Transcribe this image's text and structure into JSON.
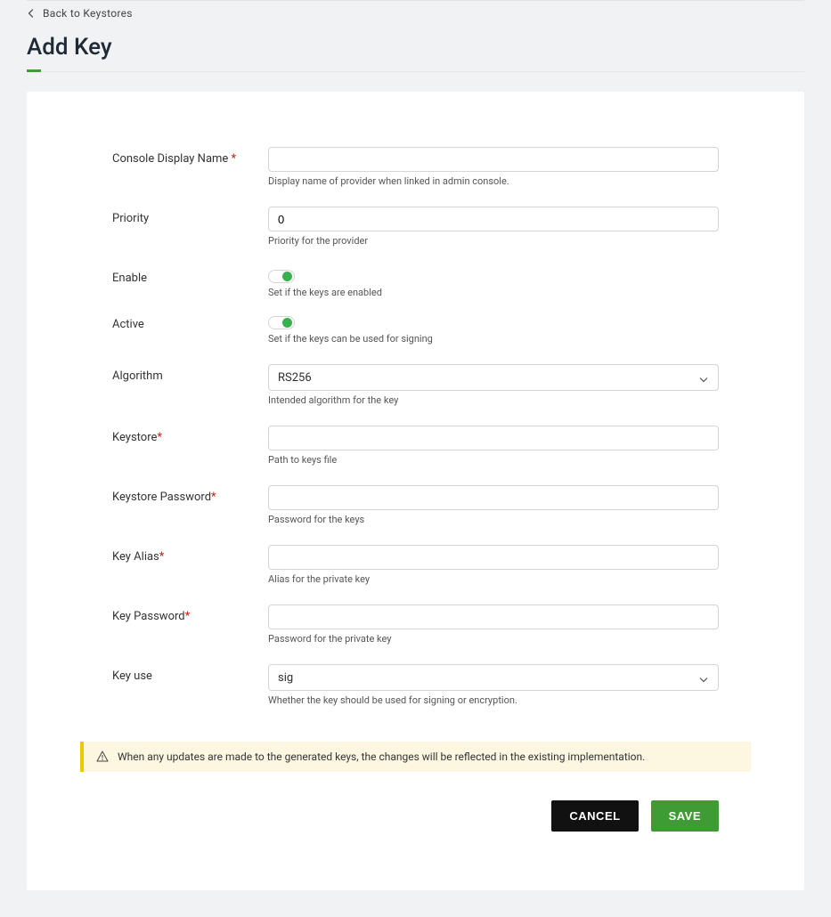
{
  "back": {
    "label": "Back to Keystores"
  },
  "page_title": "Add Key",
  "form": {
    "console_display_name": {
      "label": "Console Display Name ",
      "value": "",
      "help": "Display name of provider when linked in admin console.",
      "required": true
    },
    "priority": {
      "label": "Priority",
      "value": "0",
      "help": "Priority for the provider",
      "required": false
    },
    "enable": {
      "label": "Enable",
      "on": true,
      "help": "Set if the keys are enabled"
    },
    "active": {
      "label": "Active",
      "on": true,
      "help": "Set if the keys can be used for signing"
    },
    "algorithm": {
      "label": "Algorithm",
      "selected": "RS256",
      "help": "Intended algorithm for the key"
    },
    "keystore": {
      "label": "Keystore",
      "value": "",
      "help": "Path to keys file",
      "required": true
    },
    "keystore_password": {
      "label": "Keystore Password",
      "value": "",
      "help": "Password for the keys",
      "required": true
    },
    "key_alias": {
      "label": "Key Alias",
      "value": "",
      "help": "Alias for the private key",
      "required": true
    },
    "key_password": {
      "label": "Key Password",
      "value": "",
      "help": "Password for the private key",
      "required": true
    },
    "key_use": {
      "label": "Key use",
      "selected": "sig",
      "help": "Whether the key should be used for signing or encryption."
    }
  },
  "alert": {
    "text": "When any updates are made to the generated keys, the changes will be reflected in the existing implementation."
  },
  "buttons": {
    "cancel": "CANCEL",
    "save": "SAVE"
  },
  "req_mark": "*"
}
